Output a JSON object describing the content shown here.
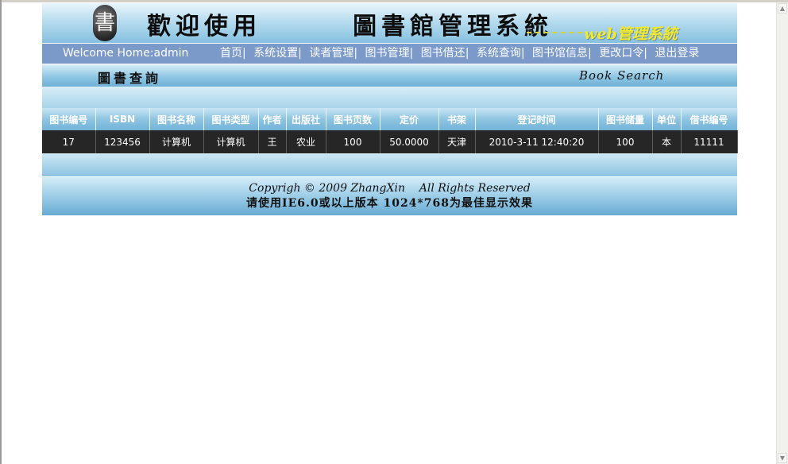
{
  "banner": {
    "seal_glyph": "書",
    "title": "歡迎使用       圖書館管理系統",
    "subtitle": "web管理系統"
  },
  "nav": {
    "welcome": "Welcome Home:admin",
    "menu": [
      "首页",
      "系统设置",
      "读者管理",
      "图书管理",
      "图书借还",
      "系统查询",
      "图书馆信息",
      "更改口令",
      "退出登录"
    ]
  },
  "section": {
    "title": "圖書查詢",
    "title_en": "Book  Search"
  },
  "table": {
    "headers": [
      "图书编号",
      "ISBN",
      "图书名称",
      "图书类型",
      "作者",
      "出版社",
      "图书页数",
      "定价",
      "书架",
      "登记时间",
      "图书储量",
      "单位",
      "借书编号"
    ],
    "rows": [
      [
        "17",
        "123456",
        "计算机",
        "计算机",
        "王",
        "农业",
        "100",
        "50.0000",
        "天津",
        "2010-3-11 12:40:20",
        "100",
        "本",
        "11111"
      ]
    ]
  },
  "footer": {
    "copyright": "Copyrigh © 2009 ZhangXin    All Rights Reserved",
    "note": "请使用IE6.0或以上版本 1024*768为最佳显示效果"
  },
  "colors": {
    "navbar": "#7b99c9",
    "row_bg": "#262626",
    "subtitle": "#f2ea2a"
  }
}
